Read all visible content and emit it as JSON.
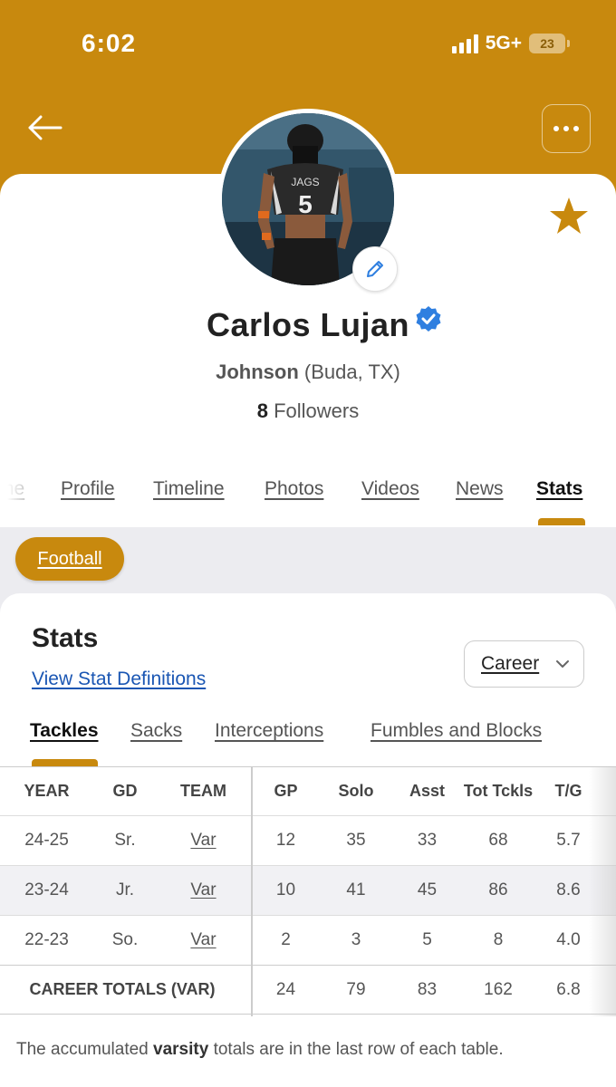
{
  "status_bar": {
    "time": "6:02",
    "network": "5G+",
    "battery": "23"
  },
  "profile": {
    "name": "Carlos Lujan",
    "school": "Johnson",
    "location": "(Buda, TX)",
    "followers_count": "8",
    "followers_label": "Followers",
    "photo_jersey_number": "5",
    "photo_jersey_text": "JAGS"
  },
  "profile_tabs": [
    {
      "label": "me"
    },
    {
      "label": "Profile"
    },
    {
      "label": "Timeline"
    },
    {
      "label": "Photos"
    },
    {
      "label": "Videos"
    },
    {
      "label": "News"
    },
    {
      "label": "Stats",
      "active": true
    }
  ],
  "sport_pill": "Football",
  "stats": {
    "title": "Stats",
    "definitions_link": "View Stat Definitions",
    "period_select": "Career",
    "tabs": [
      {
        "label": "Tackles",
        "active": true
      },
      {
        "label": "Sacks"
      },
      {
        "label": "Interceptions"
      },
      {
        "label": "Fumbles and Blocks"
      }
    ],
    "columns": [
      "YEAR",
      "GD",
      "TEAM",
      "GP",
      "Solo",
      "Asst",
      "Tot Tckls",
      "T/G"
    ],
    "rows": [
      [
        "24-25",
        "Sr.",
        "Var",
        "12",
        "35",
        "33",
        "68",
        "5.7"
      ],
      [
        "23-24",
        "Jr.",
        "Var",
        "10",
        "41",
        "45",
        "86",
        "8.6"
      ],
      [
        "22-23",
        "So.",
        "Var",
        "2",
        "3",
        "5",
        "8",
        "4.0"
      ]
    ],
    "totals": {
      "label": "CAREER TOTALS (VAR)",
      "values": [
        "24",
        "79",
        "83",
        "162",
        "6.8"
      ]
    },
    "footnote": {
      "before": "The accumulated ",
      "bold": "varsity",
      "after": " totals are in the last row of each table."
    }
  },
  "colors": {
    "brand": "#c8890e",
    "link": "#1a56b3",
    "verified": "#2f7fe0"
  }
}
